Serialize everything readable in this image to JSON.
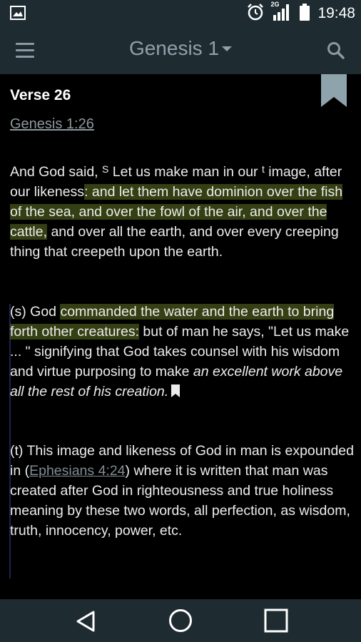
{
  "status_bar": {
    "time": "19:48",
    "network_label": "2G",
    "icons": [
      "image-icon",
      "alarm-icon",
      "signal-icon",
      "battery-icon"
    ]
  },
  "app_bar": {
    "title": "Genesis 1",
    "icons": [
      "menu-icon",
      "chevron-down-icon",
      "search-icon"
    ]
  },
  "verse": {
    "heading": "Verse 26",
    "reference": "Genesis 1:26",
    "text": {
      "a": "And God said, ",
      "note_s": "S",
      "b": " Let us make man in our ",
      "note_t": "t",
      "c": " image, after our likeness",
      "hl1": ": and let them have dominion over the fish of the sea, and over the fowl of the air, and over the cattle,",
      "d": " and over all the earth, and over every creeping thing that creepeth upon the earth."
    }
  },
  "notes": {
    "s": {
      "a": "(s) God ",
      "hl": "commanded the water and the earth to bring forth other creatures:",
      "b": " but of man he says, \"Let us make ... \" signifying that God takes counsel with his wisdom and virtue purposing to make ",
      "italic": "an excellent work above all the rest of his creation."
    },
    "t": {
      "a": "(t) This image and likeness of God in man is expounded in (",
      "link": "Ephesians 4:24",
      "b": ") where it is written that man was created after God in righteousness and true holiness meaning by these two words, all perfection, as wisdom, truth, innocency, power, etc."
    }
  },
  "nav_bar": {
    "icons": [
      "back-icon",
      "home-icon",
      "recents-icon"
    ]
  },
  "colors": {
    "bar_bg": "#1e2b31",
    "highlight": "#5f7323",
    "bookmark": "#8fa3ad"
  }
}
